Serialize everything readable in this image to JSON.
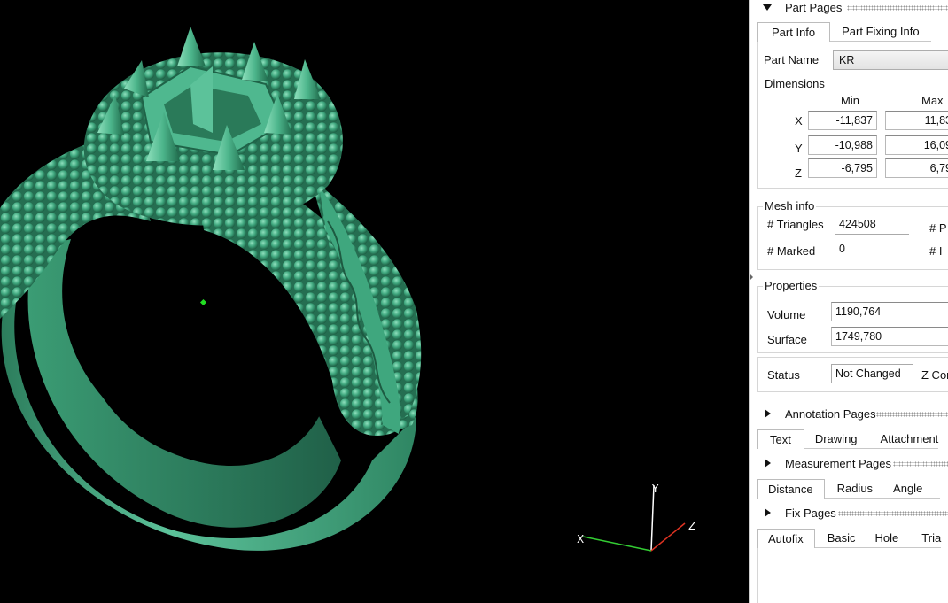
{
  "viewport": {
    "axes": {
      "x": "X",
      "y": "Y",
      "z": "Z"
    }
  },
  "part_pages": {
    "title": "Part Pages",
    "tabs": [
      "Part Info",
      "Part Fixing Info"
    ],
    "part_name_label": "Part Name",
    "part_name_value": "KR",
    "dimensions": {
      "title": "Dimensions",
      "min_label": "Min",
      "max_label": "Max",
      "rows": [
        {
          "axis": "X",
          "min": "-11,837",
          "max": "11,83"
        },
        {
          "axis": "Y",
          "min": "-10,988",
          "max": "16,09"
        },
        {
          "axis": "Z",
          "min": "-6,795",
          "max": "6,79"
        }
      ]
    },
    "mesh_info": {
      "title": "Mesh info",
      "triangles_label": "# Triangles",
      "triangles_value": "424508",
      "marked_label": "# Marked",
      "marked_value": "0",
      "right_label_1": "# P",
      "right_label_2": "# I"
    },
    "properties": {
      "title": "Properties",
      "volume_label": "Volume",
      "volume_value": "1190,764",
      "surface_label": "Surface",
      "surface_value": "1749,780"
    },
    "status": {
      "label": "Status",
      "value": "Not Changed",
      "right_label": "Z Cor"
    }
  },
  "annotation_pages": {
    "title": "Annotation Pages",
    "tabs": [
      "Text",
      "Drawing",
      "Attachment"
    ]
  },
  "measurement_pages": {
    "title": "Measurement Pages",
    "tabs": [
      "Distance",
      "Radius",
      "Angle"
    ]
  },
  "fix_pages": {
    "title": "Fix Pages",
    "tabs": [
      "Autofix",
      "Basic",
      "Hole",
      "Tria"
    ]
  },
  "colors": {
    "model": "#3fa77e",
    "viewport_bg": "#000000",
    "panel_bg": "#ffffff"
  }
}
